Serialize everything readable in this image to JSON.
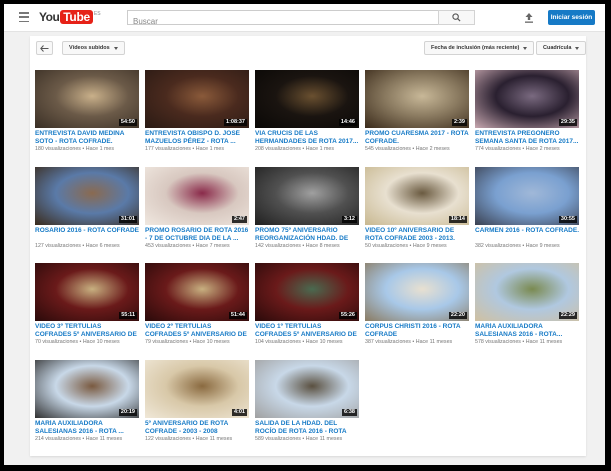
{
  "header": {
    "logo_you": "You",
    "logo_tube": "Tube",
    "logo_region": "ES",
    "search_placeholder": "Buscar",
    "signin_label": "Iniciar sesión"
  },
  "toolbar": {
    "filter_label": "Vídeos subidos",
    "sort_label": "Fecha de inclusión (más reciente)",
    "view_label": "Cuadrícula"
  },
  "videos": [
    {
      "title": "ENTREVISTA DAVID MEDINA SOTO - ROTA COFRADE.",
      "views": "180 visualizaciones",
      "age": "Hace 1 mes",
      "duration": "54:50",
      "colors": [
        "#6b5a48",
        "#c9b08a",
        "#3a2f25"
      ]
    },
    {
      "title": "ENTREVISTA OBISPO D. JOSÉ MAZUELOS PÉREZ - ROTA ...",
      "views": "177 visualizaciones",
      "age": "Hace 1 mes",
      "duration": "1:08:37",
      "colors": [
        "#4a2a1e",
        "#8a5a3a",
        "#2a1a14"
      ]
    },
    {
      "title": "VIA CRUCIS DE LAS HERMANDADES DE ROTA 2017...",
      "views": "208 visualizaciones",
      "age": "Hace 1 mes",
      "duration": "14:46",
      "colors": [
        "#1a1410",
        "#6a5030",
        "#0a0806"
      ]
    },
    {
      "title": "PROMO CUARESMA 2017 - ROTA COFRADE.",
      "views": "545 visualizaciones",
      "age": "Hace 2 meses",
      "duration": "2:39",
      "colors": [
        "#8a7a60",
        "#c8b898",
        "#3a2a1a"
      ]
    },
    {
      "title": "ENTREVISTA PREGONERO SEMANA SANTA DE ROTA 2017...",
      "views": "774 visualizaciones",
      "age": "Hace 2 meses",
      "duration": "29:35",
      "colors": [
        "#2a2030",
        "#7a6a80",
        "#c8a8b0"
      ]
    },
    {
      "title": "ROSARIO 2016 - ROTA COFRADE",
      "views": "127 visualizaciones",
      "age": "Hace 6 meses",
      "duration": "31:01",
      "colors": [
        "#5a7aa8",
        "#8a6a50",
        "#3a2a1a"
      ]
    },
    {
      "title": "PROMO ROSARIO DE ROTA 2016 - 7 DE OCTUBRE DIA DE LA ...",
      "views": "453 visualizaciones",
      "age": "Hace 7 meses",
      "duration": "2:47",
      "colors": [
        "#d8c8c0",
        "#8a2a4a",
        "#f0e8e0"
      ]
    },
    {
      "title": "PROMO 75º ANIVERSARIO REORGANIZACIÓN HDAD. DE L...",
      "views": "142 visualizaciones",
      "age": "Hace 8 meses",
      "duration": "3:12",
      "colors": [
        "#505050",
        "#a0a0a0",
        "#202020"
      ]
    },
    {
      "title": "VIDEO 10º ANIVERSARIO DE ROTA COFRADE 2003 - 2013.",
      "views": "50 visualizaciones",
      "age": "Hace 9 meses",
      "duration": "18:14",
      "colors": [
        "#e8e0d0",
        "#6a5a40",
        "#c8b890"
      ]
    },
    {
      "title": "CARMEN 2016 - ROTA COFRADE.",
      "views": "382 visualizaciones",
      "age": "Hace 9 meses",
      "duration": "30:55",
      "colors": [
        "#7aa0d0",
        "#a0b8d8",
        "#3a4050"
      ]
    },
    {
      "title": "VIDEO 3º TERTULIAS COFRADES 5º ANIVERSARIO DE ROTA...",
      "views": "70 visualizaciones",
      "age": "Hace 10 meses",
      "duration": "55:11",
      "colors": [
        "#6a1a1a",
        "#c8b080",
        "#2a0a0a"
      ]
    },
    {
      "title": "VIDEO 2º TERTULIAS COFRADES 5º ANIVERSARIO DE ROTA...",
      "views": "79 visualizaciones",
      "age": "Hace 10 meses",
      "duration": "51:44",
      "colors": [
        "#6a1a1a",
        "#c8b080",
        "#2a0a0a"
      ]
    },
    {
      "title": "VIDEO 1º TERTULIAS COFRADES 5º ANIVERSARIO DE ROTA...",
      "views": "104 visualizaciones",
      "age": "Hace 10 meses",
      "duration": "55:26",
      "colors": [
        "#6a1a1a",
        "#4a6a50",
        "#2a0a0a"
      ]
    },
    {
      "title": "CORPUS CHRISTI 2016 - ROTA COFRADE",
      "views": "387 visualizaciones",
      "age": "Hace 11 meses",
      "duration": "22:20",
      "colors": [
        "#a8c8e8",
        "#e8e0d0",
        "#8a7a60"
      ]
    },
    {
      "title": "MARÍA AUXILIADORA SALESIANAS 2016 - ROTA...",
      "views": "578 visualizaciones",
      "age": "Hace 11 meses",
      "duration": "22:29",
      "colors": [
        "#b0c8e0",
        "#7a8a50",
        "#d0c0a0"
      ]
    },
    {
      "title": "MARÍA AUXILIADORA SALESIANAS 2016 - ROTA ...",
      "views": "214 visualizaciones",
      "age": "Hace 11 meses",
      "duration": "20:19",
      "colors": [
        "#c8d8e8",
        "#7a5a40",
        "#303030"
      ]
    },
    {
      "title": "5º ANIVERSARIO DE ROTA COFRADE - 2003 - 2008",
      "views": "122 visualizaciones",
      "age": "Hace 11 meses",
      "duration": "4:01",
      "colors": [
        "#d8c8a8",
        "#8a6a40",
        "#f0e8d8"
      ]
    },
    {
      "title": "SALIDA DE LA HDAD. DEL ROCÍO DE ROTA 2016 - ROTA COFRADE",
      "views": "589 visualizaciones",
      "age": "Hace 11 meses",
      "duration": "6:38",
      "colors": [
        "#c8d8e8",
        "#5a5040",
        "#a0a0a0"
      ]
    }
  ]
}
